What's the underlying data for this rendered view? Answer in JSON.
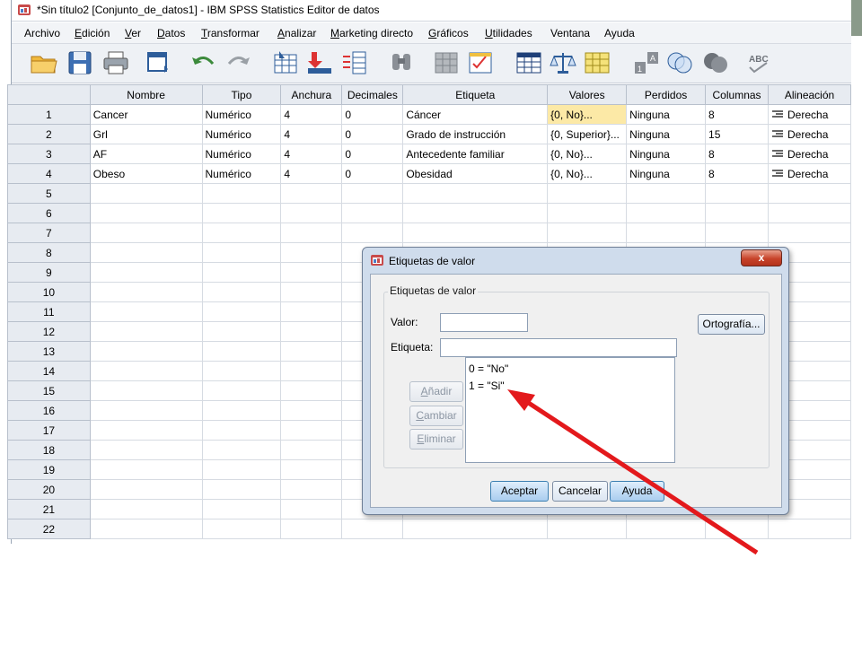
{
  "window": {
    "title": "*Sin título2 [Conjunto_de_datos1] - IBM SPSS Statistics Editor de datos"
  },
  "menubar": {
    "items": [
      {
        "label": "Archivo"
      },
      {
        "label": "Edición"
      },
      {
        "label": "Ver"
      },
      {
        "label": "Datos"
      },
      {
        "label": "Transformar"
      },
      {
        "label": "Analizar"
      },
      {
        "label": "Marketing directo"
      },
      {
        "label": "Gráficos"
      },
      {
        "label": "Utilidades"
      },
      {
        "label": "Ventana"
      },
      {
        "label": "Ayuda"
      }
    ]
  },
  "toolbar": {
    "icons": [
      "open-folder-icon",
      "save-icon",
      "print-icon",
      "recall-dialog-icon",
      "undo-icon",
      "redo-icon",
      "goto-case-icon",
      "goto-variable-icon",
      "variables-icon",
      "find-icon",
      "insert-cases-icon",
      "insert-variable-icon",
      "split-file-icon",
      "weight-cases-icon",
      "select-cases-icon",
      "value-labels-icon",
      "use-sets-icon",
      "show-all-variables-icon",
      "spell-check-icon"
    ]
  },
  "grid": {
    "columns": [
      "Nombre",
      "Tipo",
      "Anchura",
      "Decimales",
      "Etiqueta",
      "Valores",
      "Perdidos",
      "Columnas",
      "Alineación"
    ],
    "rows": [
      {
        "num": "1",
        "cells": [
          "Cancer",
          "Numérico",
          "4",
          "0",
          "Cáncer",
          "{0, No}...",
          "Ninguna",
          "8",
          "Derecha"
        ]
      },
      {
        "num": "2",
        "cells": [
          "Grl",
          "Numérico",
          "4",
          "0",
          "Grado de instrucción",
          "{0, Superior}...",
          "Ninguna",
          "15",
          "Derecha"
        ]
      },
      {
        "num": "3",
        "cells": [
          "AF",
          "Numérico",
          "4",
          "0",
          "Antecedente familiar",
          "{0, No}...",
          "Ninguna",
          "8",
          "Derecha"
        ]
      },
      {
        "num": "4",
        "cells": [
          "Obeso",
          "Numérico",
          "4",
          "0",
          "Obesidad",
          "{0, No}...",
          "Ninguna",
          "8",
          "Derecha"
        ]
      }
    ],
    "empty_rows": [
      "5",
      "6",
      "7",
      "8",
      "9",
      "10",
      "11",
      "12",
      "13",
      "14",
      "15",
      "16",
      "17",
      "18",
      "19",
      "20",
      "21",
      "22"
    ]
  },
  "dialog": {
    "title": "Etiquetas de valor",
    "group_label": "Etiquetas de valor",
    "value_label": "Valor:",
    "value_input": "",
    "label_label": "Etiqueta:",
    "label_input": "",
    "spelling_button": "Ortografía...",
    "add_button": "Añadir",
    "change_button": "Cambiar",
    "remove_button": "Eliminar",
    "labels": [
      "0 = \"No\"",
      "1 = \"Si\""
    ],
    "ok_button": "Aceptar",
    "cancel_button": "Cancelar",
    "help_button": "Ayuda",
    "close_glyph": "x"
  },
  "colors": {
    "annotation_arrow": "#e3191c",
    "selected_cell": "#fce9a6",
    "dialog_frame": "#cfdcec",
    "close_button": "#c7432a"
  }
}
